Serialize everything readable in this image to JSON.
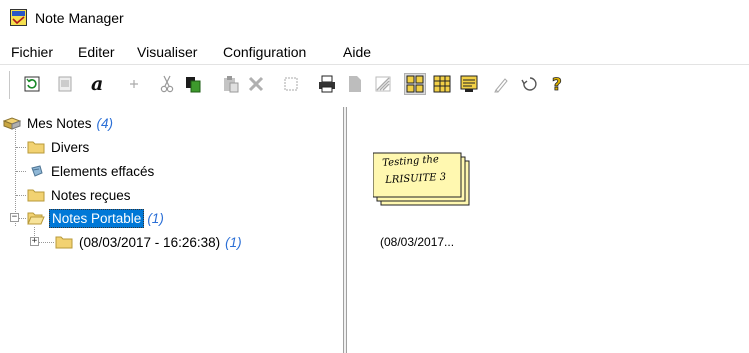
{
  "window": {
    "title": "Note Manager"
  },
  "menu": [
    "Fichier",
    "Editer",
    "Visualiser",
    "Configuration",
    "Aide"
  ],
  "toolbar": {
    "buttons": [
      "refresh-icon",
      "new-note-icon",
      "font-icon",
      "add-icon",
      "cut-icon",
      "copy-icon",
      "paste-icon",
      "delete-icon",
      "select-icon",
      "print-icon",
      "page-icon",
      "printer-setup-icon",
      "large-icons-view-icon",
      "small-icons-view-icon",
      "details-view-icon",
      "edit-icon",
      "undo-icon",
      "help-icon"
    ],
    "pressed": "large-icons-view-icon"
  },
  "tree": {
    "root": {
      "label": "Mes Notes",
      "count": "(4)"
    },
    "divers": "Divers",
    "deleted": "Elements effacés",
    "received": "Notes reçues",
    "portable": {
      "label": "Notes Portable",
      "count": "(1)"
    },
    "session": {
      "label": "(08/03/2017 - 16:26:38)",
      "count": "(1)"
    }
  },
  "note": {
    "line1": "Testing the",
    "line2": "LRISUITE 3",
    "caption": "(08/03/2017..."
  },
  "colors": {
    "selection": "#0078d7",
    "count": "#2b6fd6",
    "folder": "#f2d272",
    "note": "#fff8b0"
  }
}
